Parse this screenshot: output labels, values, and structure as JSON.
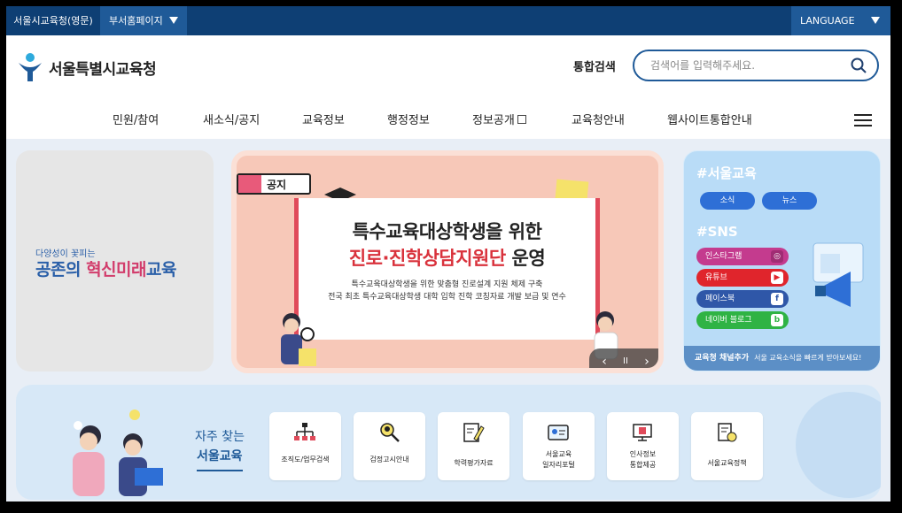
{
  "topbar": {
    "office_label": "서울시교육청(영문)",
    "dept_label": "부서홈페이지",
    "language_label": "LANGUAGE"
  },
  "header": {
    "logo_text": "서울특별시교육청",
    "search_label": "통합검색",
    "search_placeholder": "검색어를 입력해주세요."
  },
  "nav": {
    "items": [
      "민원/참여",
      "새소식/공지",
      "교육정보",
      "행정정보",
      "정보공개",
      "교육청안내",
      "웹사이트통합안내"
    ]
  },
  "left_card": {
    "slogan_small": "다양성이 꽃피는",
    "slogan_part1": "공존의 ",
    "slogan_part2": "혁신미래",
    "slogan_part3": "교육"
  },
  "banner": {
    "notice_label": "공지",
    "title_line1": "특수교육대상학생을 위한",
    "title_line2_red": "진로·진학상담지원단",
    "title_line2_rest": " 운영",
    "desc_line1": "특수교육대상학생을 위한 맞춤형 진로설계 지원 체제 구축",
    "desc_line2": "전국 최초 특수교육대상학생 대학 입학 진학 코칭자료 개발 보급 및 연수",
    "prev": "‹",
    "pause": "II",
    "next": "›"
  },
  "social": {
    "heading_edu": "#서울교육",
    "news_label": "소식",
    "news2_label": "뉴스",
    "heading_sns": "#SNS",
    "sns": [
      {
        "label": "인스타그램",
        "color": "#c43b8e",
        "icon": "instagram-icon",
        "glyph": "◎"
      },
      {
        "label": "유튜브",
        "color": "#e0252c",
        "icon": "youtube-icon",
        "glyph": "▶"
      },
      {
        "label": "페이스북",
        "color": "#2f57a8",
        "icon": "facebook-icon",
        "glyph": "f"
      },
      {
        "label": "네이버 블로그",
        "color": "#2fb344",
        "icon": "blog-icon",
        "glyph": "b"
      }
    ],
    "footer_bold": "교육청 채널추가",
    "footer_text": "서울 교육소식을 빠르게 받아보세요!"
  },
  "quick": {
    "title1": "자주 찾는",
    "title2": "서울교육",
    "links": [
      {
        "label1": "조직도/업무검색",
        "label2": "",
        "icon": "org-chart-icon"
      },
      {
        "label1": "검정고시안내",
        "label2": "",
        "icon": "search-person-icon"
      },
      {
        "label1": "학력평가자료",
        "label2": "",
        "icon": "pencil-doc-icon"
      },
      {
        "label1": "서울교육",
        "label2": "일자리포털",
        "icon": "id-card-icon"
      },
      {
        "label1": "인사정보",
        "label2": "통합제공",
        "icon": "monitor-icon"
      },
      {
        "label1": "서울교육정책",
        "label2": "",
        "icon": "policy-doc-icon"
      }
    ]
  },
  "colors": {
    "primary": "#0e3f74",
    "accent": "#1f5a98",
    "red": "#d9323c"
  }
}
